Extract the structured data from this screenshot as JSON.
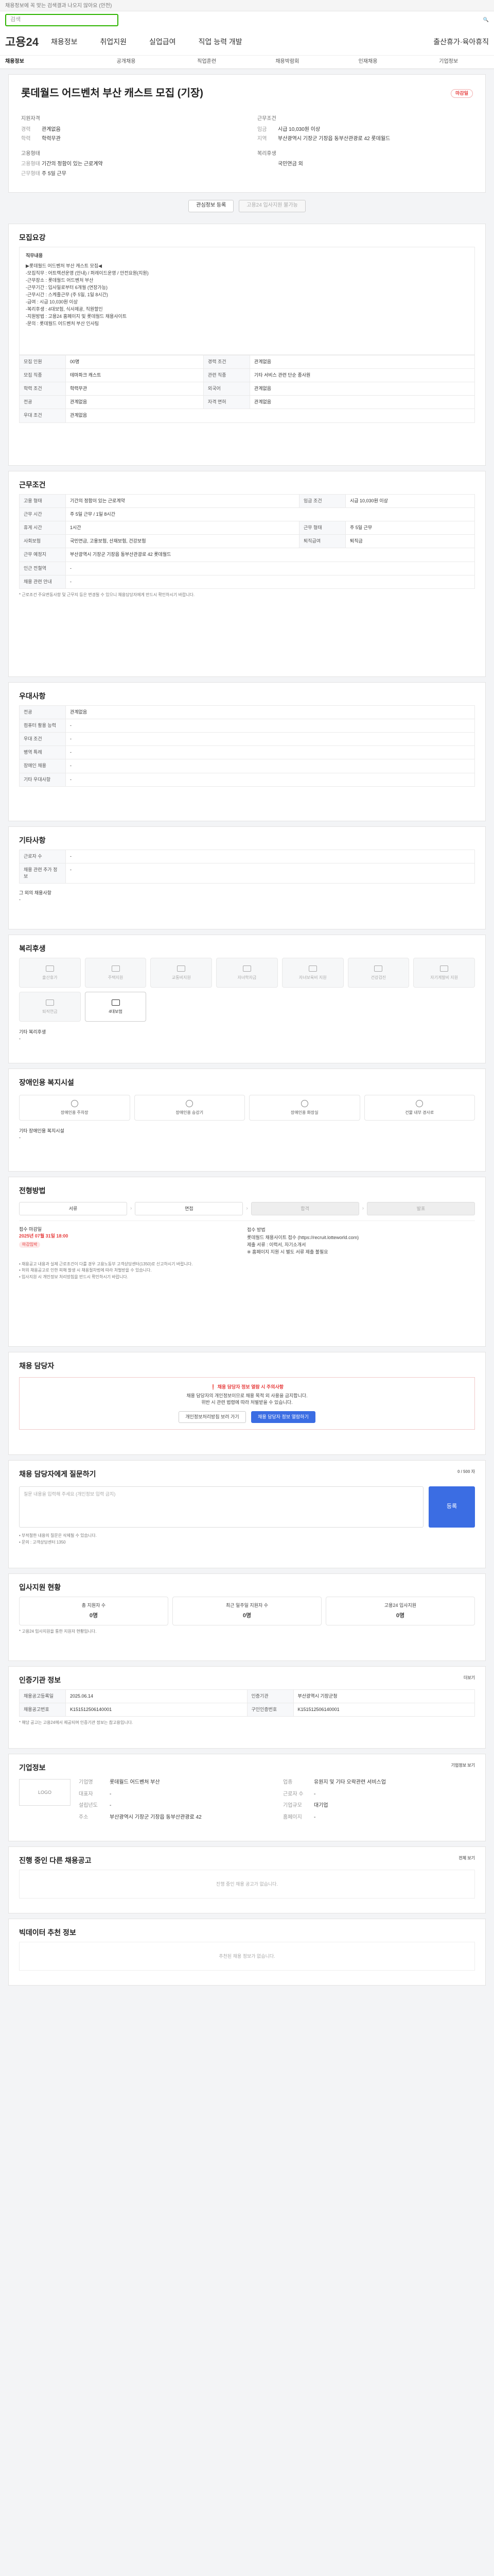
{
  "topbar": {
    "notice": "채용정보에 꼭 맞는 검색결과 나오지 않아요 (안전)"
  },
  "search": {
    "placeholder": "검색"
  },
  "header": {
    "logo": "고용24",
    "gnb": [
      "채용정보",
      "취업지원",
      "실업급여",
      "직업 능력 개발",
      "출산휴가·육아휴직"
    ]
  },
  "lnb": [
    "채용정보",
    "공개채용",
    "직업훈련",
    "채용박람회",
    "인재채용",
    "기업정보"
  ],
  "job": {
    "title": "롯데월드 어드벤처 부산 캐스트 모집 (기장)",
    "badge": "마감일",
    "left_head": "지원자격",
    "left": [
      [
        "경력",
        "관계없음"
      ],
      [
        "학력",
        "학력무관"
      ]
    ],
    "right_head": "근무조건",
    "right": [
      [
        "임금",
        "시급 10,030원 이상"
      ],
      [
        "지역",
        "부산광역시 기장군 기장읍 동부산관광로 42 롯데월드"
      ]
    ],
    "left2_head": "고용형태",
    "left2": [
      [
        "고용형태",
        "기간의 정함이 있는 근로계약"
      ],
      [
        "근무형태",
        "주 5일 근무"
      ]
    ],
    "right2_head": "복리후생",
    "right2": [
      [
        "",
        "국민연금 외"
      ]
    ]
  },
  "buttons": {
    "bookmark": "관심정보 등록",
    "apply": "고용24 입사지원 불가능"
  },
  "recruit": {
    "title": "모집요강",
    "job_head": "직무내용",
    "body": "▶롯데월드 어드벤처 부산 캐스트 모집◀\n-모집직무 : 어트랙션운영 (안내) / 퍼레이드운영 / 안전요원(지원)\n-근무장소 : 롯데월드 어드벤처 부산\n-근무기간 : 입사일로부터 6개월 (연장가능)\n-근무시간 : 스케줄근무 (주 5일, 1일 8시간)\n-급여 : 시급 10,030원 이상\n-복리후생 : 4대보험, 식사제공, 직원할인\n-지원방법 : 고용24 홈페이지 및 롯데월드 채용사이트\n-문의 : 롯데월드 어드벤처 부산 인사팀",
    "rows": [
      [
        "모집 인원",
        "00명",
        "경력 조건",
        "관계없음"
      ],
      [
        "모집 직종",
        "테마파크 캐스트",
        "관련 직종",
        "기타 서비스 관련 단순 종사원"
      ],
      [
        "학력 조건",
        "학력무관",
        "외국어",
        "관계없음"
      ],
      [
        "전공",
        "관계없음",
        "자격 면허",
        "관계없음"
      ],
      [
        "우대 조건",
        "관계없음",
        "",
        ""
      ]
    ]
  },
  "work": {
    "title": "근무조건",
    "rows": [
      [
        "고용 형태",
        "기간의 정함이 있는 근로계약",
        "임금 조건",
        "시급 10,030원 이상"
      ],
      [
        "근무 시간",
        "주 5일 근무 / 1일 8시간",
        "",
        ""
      ],
      [
        "휴게 시간",
        "1시간",
        "근무 형태",
        "주 5일 근무"
      ],
      [
        "사회보험",
        "국민연금, 고용보험, 산재보험, 건강보험",
        "퇴직급여",
        "퇴직금"
      ],
      [
        "근무 예정지",
        "부산광역시 기장군 기장읍 동부산관광로 42 롯데월드",
        "",
        ""
      ],
      [
        "인근 전철역",
        "-",
        "",
        ""
      ],
      [
        "채용 관련 안내",
        "-",
        "",
        ""
      ]
    ],
    "note": "* 근로조건 주요변동사항 및 근무지 등은 변경될 수 있으니 채용담당자에게 반드시 확인하시기 바랍니다."
  },
  "pref": {
    "title": "우대사항",
    "rows": [
      [
        "전공",
        "관계없음"
      ],
      [
        "컴퓨터 활용 능력",
        "-"
      ],
      [
        "우대 조건",
        "-"
      ],
      [
        "병역 특례",
        "-"
      ],
      [
        "장애인 채용",
        "-"
      ],
      [
        "기타 우대사항",
        "-"
      ]
    ]
  },
  "etc": {
    "title": "기타사항",
    "rows": [
      [
        "근로자 수",
        "-"
      ],
      [
        "채용 관련 추가 정보",
        "-"
      ]
    ],
    "sub": "그 외의 채용사항",
    "sub_v": "-"
  },
  "welfare": {
    "title": "복리후생",
    "items": [
      "출산휴가",
      "주택지원",
      "교통비지원",
      "자녀학자금",
      "자녀보육비 지원",
      "건강검진",
      "자기계발비 지원",
      "퇴직연금",
      "4대보험"
    ],
    "active": [
      8
    ],
    "other_label": "기타 복리후생",
    "other_v": "-"
  },
  "disability": {
    "title": "장애인용 복지시설",
    "items": [
      "장애인용 주차장",
      "장애인용 승강기",
      "장애인용 화장실",
      "건물 내부 경사로"
    ],
    "other_label": "기타 장애인용 복지시설",
    "other_v": "-"
  },
  "apply_info": {
    "title": "전형방법",
    "steps": [
      "서류",
      "면접",
      "합격",
      "발표"
    ],
    "off": [
      2,
      3
    ],
    "left_head": "접수 마감일",
    "date": "2025년 07월 31일 18:00",
    "chip": "마감임박",
    "right_head": "접수 방법",
    "right": "롯데월드 채용사이트 접수 (https://recruit.lotteworld.com)\n제출 서류 : 이력서, 자기소개서\n※ 홈페이지 지원 시 별도 서류 제출 불필요",
    "bullets": "• 채용공고 내용과 실제 근로조건이 다를 경우 고용노동부 고객상담센터(1350)로 신고하시기 바랍니다.\n• 허위 채용공고로 인한 피해 발생 시 채용절차법에 따라 처벌받을 수 있습니다.\n• 입사지원 시 개인정보 처리방침을 반드시 확인하시기 바랍니다."
  },
  "contact": {
    "title": "채용 담당자",
    "warn": "❗ 채용 담당자 정보 열람 시 주의사항",
    "text": "채용 담당자의 개인정보이므로 채용 목적 외 사용을 금지합니다.\n위반 시 관련 법령에 따라 처벌받을 수 있습니다.",
    "btn1": "개인정보처리방침 보러 가기",
    "btn2": "채용 담당자 정보 열람하기"
  },
  "qna": {
    "title": "채용 담당자에게 질문하기",
    "counter": "0 / 500 자",
    "placeholder": "질문 내용을 입력해 주세요 (개인정보 입력 금지)",
    "btn": "등록",
    "notes": "• 부적절한 내용의 질문은 삭제될 수 있습니다.\n• 문의 : 고객상담센터 1350"
  },
  "status": {
    "title": "입사지원 현황",
    "items": [
      [
        "총 지원자 수",
        "0명"
      ],
      [
        "최근 일주일 지원자 수",
        "0명"
      ],
      [
        "고용24 입사지원",
        "0명"
      ]
    ],
    "note": "* 고용24 입사지원을 통한 지원자 현황입니다."
  },
  "manage": {
    "title": "인증기관 정보",
    "more": "더보기",
    "rows": [
      [
        "채용공고등록일",
        "2025.06.14",
        "인증기관",
        "부산광역시 기장군청"
      ],
      [
        "채용공고번호",
        "K151512506140001",
        "구인인증번호",
        "K151512506140001"
      ]
    ],
    "note": "* 해당 공고는 고용24에서 제공되며 인증기관 정보는 참고용입니다."
  },
  "company": {
    "title": "기업정보",
    "logo": "LOGO",
    "btn": "기업정보 보기",
    "rows": [
      [
        "기업명",
        "롯데월드 어드벤처 부산"
      ],
      [
        "업종",
        "유원지 및 기타 오락관련 서비스업"
      ],
      [
        "대표자",
        "-"
      ],
      [
        "근로자 수",
        "-"
      ],
      [
        "설립년도",
        "-"
      ],
      [
        "기업규모",
        "대기업"
      ],
      [
        "주소",
        "부산광역시 기장군 기장읍 동부산관광로 42"
      ],
      [
        "홈페이지",
        "-"
      ]
    ]
  },
  "other": {
    "title": "진행 중인 다른 채용공고",
    "more": "전체 보기",
    "empty": "진행 중인 채용 공고가 없습니다."
  },
  "recommend": {
    "title": "빅데이터 추천 정보",
    "empty": "추천된 채용 정보가 없습니다."
  }
}
